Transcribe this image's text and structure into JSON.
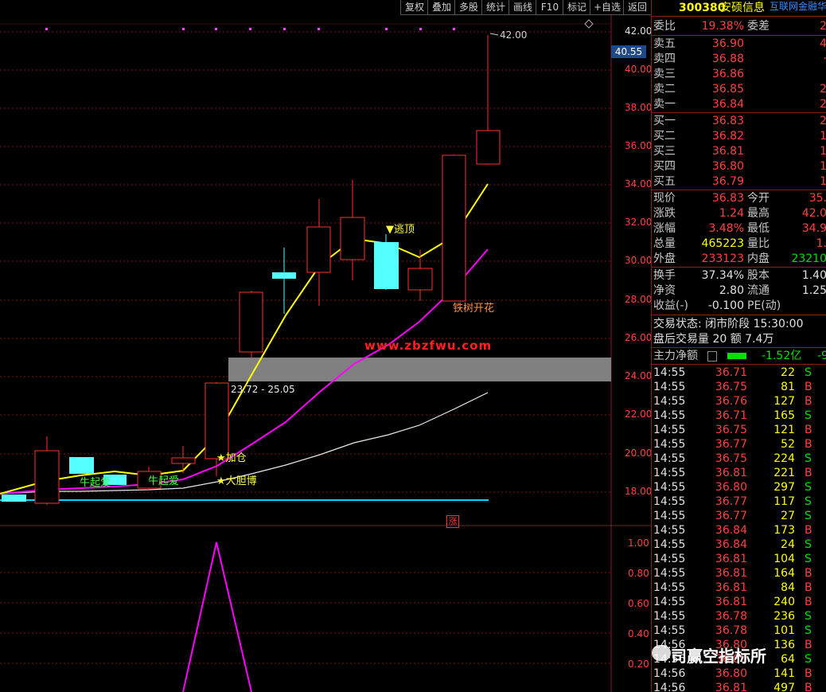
{
  "toolbar": {
    "buttons": [
      "复权",
      "叠加",
      "多股",
      "统计",
      "画线",
      "F10",
      "标记",
      "+自选",
      "返回"
    ]
  },
  "chart": {
    "price_ticks": [
      "42.00",
      "40.00",
      "38.00",
      "36.00",
      "34.00",
      "32.00",
      "30.00",
      "28.00",
      "26.00",
      "24.00",
      "22.00",
      "20.00",
      "18.00"
    ],
    "current_price_label": "40.55",
    "high_label": "42.00",
    "zone_label": "23.72 - 25.05",
    "watermark": "www.zbzfwu.com",
    "annotations": {
      "escape_top": "▼逃顶",
      "iron_tree": "铁树开花",
      "add_position": "★加仓",
      "bold_bet": "★大胆博",
      "start_up_1": "牛起爱",
      "start_up_2": "牛起爱",
      "zhang": "涨"
    },
    "sub_ticks": [
      "1.00",
      "0.80",
      "0.60",
      "0.40",
      "0.20"
    ],
    "colors": {
      "up": "#ff3030",
      "down": "#54ffff",
      "ma_fast": "#ffff00",
      "ma_mid": "#ff00ff",
      "ma_slow": "#e8e8e8",
      "zone": "#808080"
    }
  },
  "quote": {
    "code": "300380",
    "name": "安硕信息",
    "source": "互联网金融华",
    "wei_bi_label": "委比",
    "wei_bi_value": "19.38%",
    "wei_cha_label": "委差",
    "wei_cha_value": "2",
    "asks": [
      {
        "label": "卖五",
        "price": "36.90",
        "vol": "4"
      },
      {
        "label": "卖四",
        "price": "36.88",
        "vol": "·"
      },
      {
        "label": "卖三",
        "price": "36.86",
        "vol": ""
      },
      {
        "label": "卖二",
        "price": "36.85",
        "vol": "2"
      },
      {
        "label": "卖一",
        "price": "36.84",
        "vol": "2"
      }
    ],
    "bids": [
      {
        "label": "买一",
        "price": "36.83",
        "vol": "2"
      },
      {
        "label": "买二",
        "price": "36.82",
        "vol": "1"
      },
      {
        "label": "买三",
        "price": "36.81",
        "vol": "1"
      },
      {
        "label": "买四",
        "price": "36.80",
        "vol": "1"
      },
      {
        "label": "买五",
        "price": "36.79",
        "vol": "1"
      }
    ],
    "stats": [
      {
        "l1": "现价",
        "v1": "36.83",
        "l2": "今开",
        "v2": "35.",
        "c1": "red",
        "c2": "red"
      },
      {
        "l1": "涨跌",
        "v1": "1.24",
        "l2": "最高",
        "v2": "42.0",
        "c1": "red",
        "c2": "red"
      },
      {
        "l1": "涨幅",
        "v1": "3.48%",
        "l2": "最低",
        "v2": "34.9",
        "c1": "red",
        "c2": "red"
      },
      {
        "l1": "总量",
        "v1": "465223",
        "l2": "量比",
        "v2": "1.",
        "c1": "yellow",
        "c2": "red"
      },
      {
        "l1": "外盘",
        "v1": "233123",
        "l2": "内盘",
        "v2": "23210",
        "c1": "red",
        "c2": "green"
      }
    ],
    "stats2": [
      {
        "l1": "换手",
        "v1": "37.34%",
        "l2": "股本",
        "v2": "1.40"
      },
      {
        "l1": "净资",
        "v1": "2.80",
        "l2": "流通",
        "v2": "1.25"
      },
      {
        "l1": "收益(-)",
        "v1": "-0.100",
        "l2": "PE(动)",
        "v2": ""
      }
    ],
    "trade_status": "交易状态: 闭市阶段 15:30:00",
    "after_hours": "盘后交易量 20 额 7.4万",
    "main_flow_label": "主力净额",
    "main_flow_value": "-1.52亿",
    "main_flow_tail": "-9",
    "ticks": [
      {
        "t": "14:55",
        "p": "36.71",
        "v": "22",
        "s": "S"
      },
      {
        "t": "14:55",
        "p": "36.75",
        "v": "81",
        "s": "B"
      },
      {
        "t": "14:55",
        "p": "36.76",
        "v": "127",
        "s": "B"
      },
      {
        "t": "14:55",
        "p": "36.71",
        "v": "165",
        "s": "S"
      },
      {
        "t": "14:55",
        "p": "36.75",
        "v": "121",
        "s": "B"
      },
      {
        "t": "14:55",
        "p": "36.77",
        "v": "52",
        "s": "B"
      },
      {
        "t": "14:55",
        "p": "36.75",
        "v": "224",
        "s": "S"
      },
      {
        "t": "14:55",
        "p": "36.81",
        "v": "221",
        "s": "B"
      },
      {
        "t": "14:55",
        "p": "36.80",
        "v": "297",
        "s": "S"
      },
      {
        "t": "14:55",
        "p": "36.77",
        "v": "117",
        "s": "S"
      },
      {
        "t": "14:55",
        "p": "36.77",
        "v": "27",
        "s": "S"
      },
      {
        "t": "14:55",
        "p": "36.84",
        "v": "173",
        "s": "B"
      },
      {
        "t": "14:55",
        "p": "36.84",
        "v": "24",
        "s": "S"
      },
      {
        "t": "14:55",
        "p": "36.81",
        "v": "104",
        "s": "S"
      },
      {
        "t": "14:55",
        "p": "36.81",
        "v": "164",
        "s": "B"
      },
      {
        "t": "14:55",
        "p": "36.81",
        "v": "84",
        "s": "B"
      },
      {
        "t": "14:55",
        "p": "36.81",
        "v": "240",
        "s": "B"
      },
      {
        "t": "14:55",
        "p": "36.78",
        "v": "236",
        "s": "S"
      },
      {
        "t": "14:55",
        "p": "36.78",
        "v": "101",
        "s": "S"
      },
      {
        "t": "14:56",
        "p": "36.80",
        "v": "136",
        "s": "B"
      },
      {
        "t": "14:56",
        "p": "36.80",
        "v": "64",
        "s": "S"
      },
      {
        "t": "14:56",
        "p": "36.80",
        "v": "141",
        "s": "B"
      },
      {
        "t": "14:56",
        "p": "36.81",
        "v": "497",
        "s": "B"
      }
    ]
  },
  "overlay_watermark": "司赢空指标所"
}
